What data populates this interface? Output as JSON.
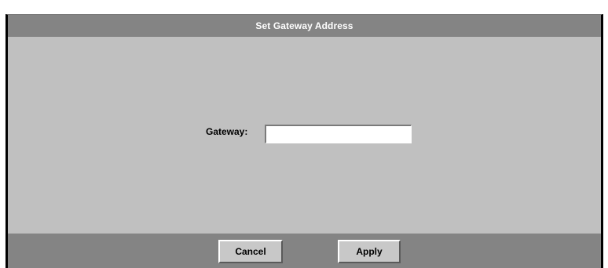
{
  "dialog": {
    "title": "Set Gateway Address"
  },
  "form": {
    "gateway_label": "Gateway:",
    "gateway_value": "",
    "gateway_placeholder": ""
  },
  "buttons": {
    "cancel_label": "Cancel",
    "apply_label": "Apply"
  }
}
